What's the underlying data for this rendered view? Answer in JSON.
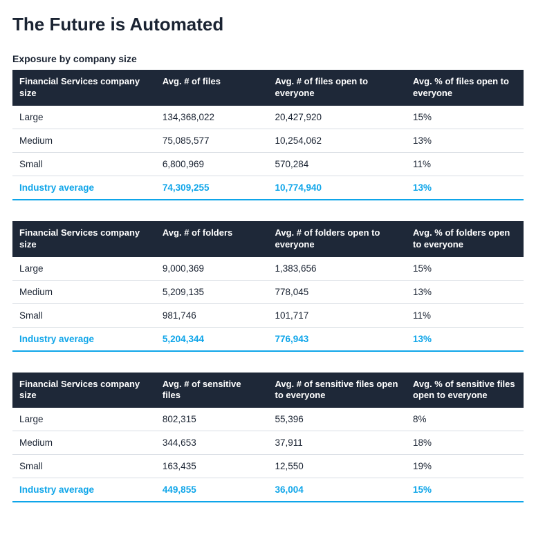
{
  "title": "The Future is Automated",
  "subtitle": "Exposure by company size",
  "tables": [
    {
      "headers": [
        "Financial Services company size",
        "Avg. # of files",
        "Avg. # of files open to everyone",
        "Avg. % of files open to everyone"
      ],
      "rows": [
        {
          "label": "Large",
          "c1": "134,368,022",
          "c2": "20,427,920",
          "c3": "15%"
        },
        {
          "label": "Medium",
          "c1": "75,085,577",
          "c2": "10,254,062",
          "c3": "13%"
        },
        {
          "label": "Small",
          "c1": "6,800,969",
          "c2": "570,284",
          "c3": "11%"
        }
      ],
      "avg": {
        "label": "Industry average",
        "c1": "74,309,255",
        "c2": "10,774,940",
        "c3": "13%"
      }
    },
    {
      "headers": [
        "Financial Services company size",
        "Avg. # of folders",
        "Avg. # of folders open to everyone",
        "Avg. % of folders open to everyone"
      ],
      "rows": [
        {
          "label": "Large",
          "c1": "9,000,369",
          "c2": "1,383,656",
          "c3": "15%"
        },
        {
          "label": "Medium",
          "c1": "5,209,135",
          "c2": "778,045",
          "c3": "13%"
        },
        {
          "label": "Small",
          "c1": "981,746",
          "c2": "101,717",
          "c3": "11%"
        }
      ],
      "avg": {
        "label": "Industry average",
        "c1": "5,204,344",
        "c2": "776,943",
        "c3": "13%"
      }
    },
    {
      "headers": [
        "Financial Services company size",
        "Avg. # of sensitive files",
        "Avg. # of sensitive files open to everyone",
        "Avg. % of sensitive files open to everyone"
      ],
      "rows": [
        {
          "label": "Large",
          "c1": "802,315",
          "c2": "55,396",
          "c3": "8%"
        },
        {
          "label": "Medium",
          "c1": "344,653",
          "c2": "37,911",
          "c3": "18%"
        },
        {
          "label": "Small",
          "c1": "163,435",
          "c2": "12,550",
          "c3": "19%"
        }
      ],
      "avg": {
        "label": "Industry average",
        "c1": "449,855",
        "c2": "36,004",
        "c3": "15%"
      }
    }
  ]
}
